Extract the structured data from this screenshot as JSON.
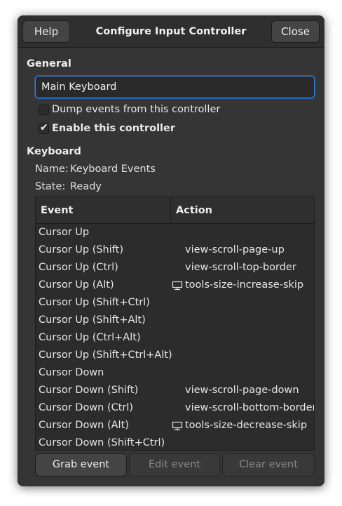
{
  "header": {
    "help_label": "Help",
    "title": "Configure Input Controller",
    "close_label": "Close"
  },
  "general": {
    "section_label": "General",
    "name_value": "Main Keyboard",
    "dump_events_label": "Dump events from this controller",
    "dump_events_checked": false,
    "enable_label": "Enable this controller",
    "enable_checked": true
  },
  "keyboard": {
    "section_label": "Keyboard",
    "name_key": "Name:",
    "name_value": "Keyboard Events",
    "state_key": "State:",
    "state_value": "Ready"
  },
  "table": {
    "col_event": "Event",
    "col_action": "Action",
    "rows": [
      {
        "event": "Cursor Up",
        "action": "",
        "icon": ""
      },
      {
        "event": "Cursor Up (Shift)",
        "action": "view-scroll-page-up",
        "icon": ""
      },
      {
        "event": "Cursor Up (Ctrl)",
        "action": "view-scroll-top-border",
        "icon": ""
      },
      {
        "event": "Cursor Up (Alt)",
        "action": "tools-size-increase-skip",
        "icon": "tool-size-icon"
      },
      {
        "event": "Cursor Up (Shift+Ctrl)",
        "action": "",
        "icon": ""
      },
      {
        "event": "Cursor Up (Shift+Alt)",
        "action": "",
        "icon": ""
      },
      {
        "event": "Cursor Up (Ctrl+Alt)",
        "action": "",
        "icon": ""
      },
      {
        "event": "Cursor Up (Shift+Ctrl+Alt)",
        "action": "",
        "icon": ""
      },
      {
        "event": "Cursor Down",
        "action": "",
        "icon": ""
      },
      {
        "event": "Cursor Down (Shift)",
        "action": "view-scroll-page-down",
        "icon": ""
      },
      {
        "event": "Cursor Down (Ctrl)",
        "action": "view-scroll-bottom-border",
        "icon": ""
      },
      {
        "event": "Cursor Down (Alt)",
        "action": "tools-size-decrease-skip",
        "icon": "tool-size-icon"
      },
      {
        "event": "Cursor Down (Shift+Ctrl)",
        "action": "",
        "icon": ""
      }
    ]
  },
  "buttons": {
    "grab_label": "Grab event",
    "edit_label": "Edit event",
    "edit_enabled": false,
    "clear_label": "Clear event",
    "clear_enabled": false
  }
}
